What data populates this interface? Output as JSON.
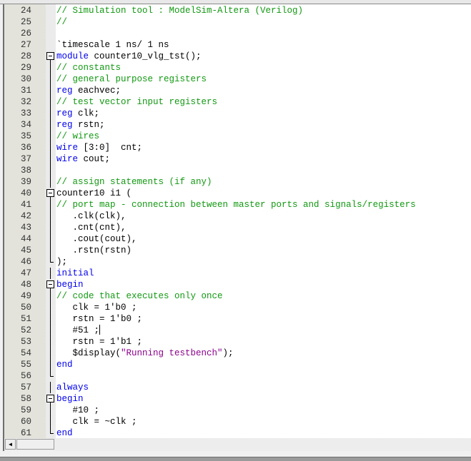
{
  "editor": {
    "language": "Verilog",
    "cursor": {
      "line": 52,
      "after_text": "#51 ;"
    },
    "lines": [
      {
        "num": "24",
        "segments": [
          {
            "t": "cm",
            "v": "// Simulation tool : ModelSim-Altera (Verilog)"
          }
        ]
      },
      {
        "num": "25",
        "segments": [
          {
            "t": "cm",
            "v": "//"
          }
        ]
      },
      {
        "num": "26",
        "segments": []
      },
      {
        "num": "27",
        "segments": [
          {
            "t": "tx",
            "v": "`timescale 1 ns/ 1 ns"
          }
        ]
      },
      {
        "num": "28",
        "fold": "open",
        "segments": [
          {
            "t": "kw",
            "v": "module"
          },
          {
            "t": "tx",
            "v": " counter10_vlg_tst();"
          }
        ]
      },
      {
        "num": "29",
        "fold": "line",
        "segments": [
          {
            "t": "cm",
            "v": "// constants"
          }
        ]
      },
      {
        "num": "30",
        "fold": "line",
        "segments": [
          {
            "t": "cm",
            "v": "// general purpose registers"
          }
        ]
      },
      {
        "num": "31",
        "fold": "line",
        "segments": [
          {
            "t": "kw",
            "v": "reg"
          },
          {
            "t": "tx",
            "v": " eachvec;"
          }
        ]
      },
      {
        "num": "32",
        "fold": "line",
        "segments": [
          {
            "t": "cm",
            "v": "// test vector input registers"
          }
        ]
      },
      {
        "num": "33",
        "fold": "line",
        "segments": [
          {
            "t": "kw",
            "v": "reg"
          },
          {
            "t": "tx",
            "v": " clk;"
          }
        ]
      },
      {
        "num": "34",
        "fold": "line",
        "segments": [
          {
            "t": "kw",
            "v": "reg"
          },
          {
            "t": "tx",
            "v": " rstn;"
          }
        ]
      },
      {
        "num": "35",
        "fold": "line",
        "segments": [
          {
            "t": "cm",
            "v": "// wires"
          }
        ]
      },
      {
        "num": "36",
        "fold": "line",
        "segments": [
          {
            "t": "kw",
            "v": "wire"
          },
          {
            "t": "tx",
            "v": " [3:0]  cnt;"
          }
        ]
      },
      {
        "num": "37",
        "fold": "line",
        "segments": [
          {
            "t": "kw",
            "v": "wire"
          },
          {
            "t": "tx",
            "v": " cout;"
          }
        ]
      },
      {
        "num": "38",
        "fold": "line",
        "segments": []
      },
      {
        "num": "39",
        "fold": "line",
        "segments": [
          {
            "t": "cm",
            "v": "// assign statements (if any)"
          }
        ]
      },
      {
        "num": "40",
        "fold": "open",
        "segments": [
          {
            "t": "tx",
            "v": "counter10 i1 ("
          }
        ]
      },
      {
        "num": "41",
        "fold": "line",
        "segments": [
          {
            "t": "cm",
            "v": "// port map - connection between master ports and signals/registers"
          }
        ]
      },
      {
        "num": "42",
        "fold": "line",
        "segments": [
          {
            "t": "tx",
            "v": "   .clk(clk),"
          }
        ]
      },
      {
        "num": "43",
        "fold": "line",
        "segments": [
          {
            "t": "tx",
            "v": "   .cnt(cnt),"
          }
        ]
      },
      {
        "num": "44",
        "fold": "line",
        "segments": [
          {
            "t": "tx",
            "v": "   .cout(cout),"
          }
        ]
      },
      {
        "num": "45",
        "fold": "line",
        "segments": [
          {
            "t": "tx",
            "v": "   .rstn(rstn)"
          }
        ]
      },
      {
        "num": "46",
        "fold": "end",
        "segments": [
          {
            "t": "tx",
            "v": ");"
          }
        ]
      },
      {
        "num": "47",
        "fold": "line",
        "segments": [
          {
            "t": "kw",
            "v": "initial"
          }
        ]
      },
      {
        "num": "48",
        "fold": "open",
        "segments": [
          {
            "t": "kw",
            "v": "begin"
          }
        ]
      },
      {
        "num": "49",
        "fold": "line",
        "segments": [
          {
            "t": "cm",
            "v": "// code that executes only once"
          }
        ]
      },
      {
        "num": "50",
        "fold": "line",
        "segments": [
          {
            "t": "tx",
            "v": "   clk = 1'b0 ;"
          }
        ]
      },
      {
        "num": "51",
        "fold": "line",
        "segments": [
          {
            "t": "tx",
            "v": "   rstn = 1'b0 ;"
          }
        ]
      },
      {
        "num": "52",
        "fold": "line",
        "caret": true,
        "segments": [
          {
            "t": "tx",
            "v": "   #51 ;"
          }
        ]
      },
      {
        "num": "53",
        "fold": "line",
        "segments": [
          {
            "t": "tx",
            "v": "   rstn = 1'b1 ;"
          }
        ]
      },
      {
        "num": "54",
        "fold": "line",
        "segments": [
          {
            "t": "tx",
            "v": "   $display("
          },
          {
            "t": "str",
            "v": "\"Running testbench\""
          },
          {
            "t": "tx",
            "v": ");"
          }
        ]
      },
      {
        "num": "55",
        "fold": "line",
        "segments": [
          {
            "t": "kw",
            "v": "end"
          }
        ]
      },
      {
        "num": "56",
        "fold": "end",
        "segments": []
      },
      {
        "num": "57",
        "fold": "line",
        "segments": [
          {
            "t": "kw",
            "v": "always"
          }
        ]
      },
      {
        "num": "58",
        "fold": "open",
        "segments": [
          {
            "t": "kw",
            "v": "begin"
          }
        ]
      },
      {
        "num": "59",
        "fold": "line",
        "segments": [
          {
            "t": "tx",
            "v": "   #10 ;"
          }
        ]
      },
      {
        "num": "60",
        "fold": "line",
        "segments": [
          {
            "t": "tx",
            "v": "   clk = ~clk ;"
          }
        ]
      },
      {
        "num": "61",
        "fold": "end",
        "segments": [
          {
            "t": "kw",
            "v": "end"
          }
        ]
      }
    ]
  },
  "scrollbar": {
    "left_arrow_icon": "◀",
    "position_fraction": 0.0
  },
  "colors": {
    "keyword": "#0000ee",
    "comment": "#119911",
    "string": "#8b008b",
    "text": "#000000",
    "gutter": "#e3e3db"
  }
}
